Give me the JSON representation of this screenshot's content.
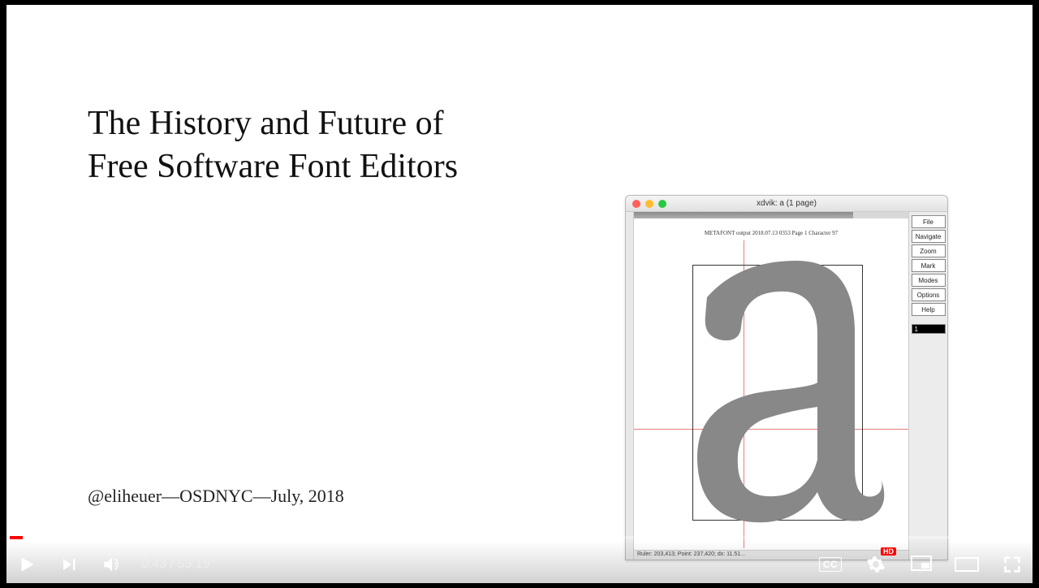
{
  "slide": {
    "title_line1": "The History and Future of",
    "title_line2": "Free Software Font Editors",
    "byline": "@eliheuer—OSDNYC—July, 2018"
  },
  "xdvi": {
    "window_title": "xdvik:  a  (1 page)",
    "meta_text": "METAFONT output 2018.07.13 0353   Page 1   Character  97",
    "status_text": "Ruler: 203,413; Point: 237,420; dx: 11.51…",
    "buttons": [
      "File",
      "Navigate",
      "Zoom",
      "Mark",
      "Modes",
      "Options",
      "Help"
    ],
    "thumb_label": "1"
  },
  "player": {
    "current_time": "0:43",
    "duration": "53:19",
    "separator": " / ",
    "cc_label": "CC",
    "hd_label": "HD"
  }
}
